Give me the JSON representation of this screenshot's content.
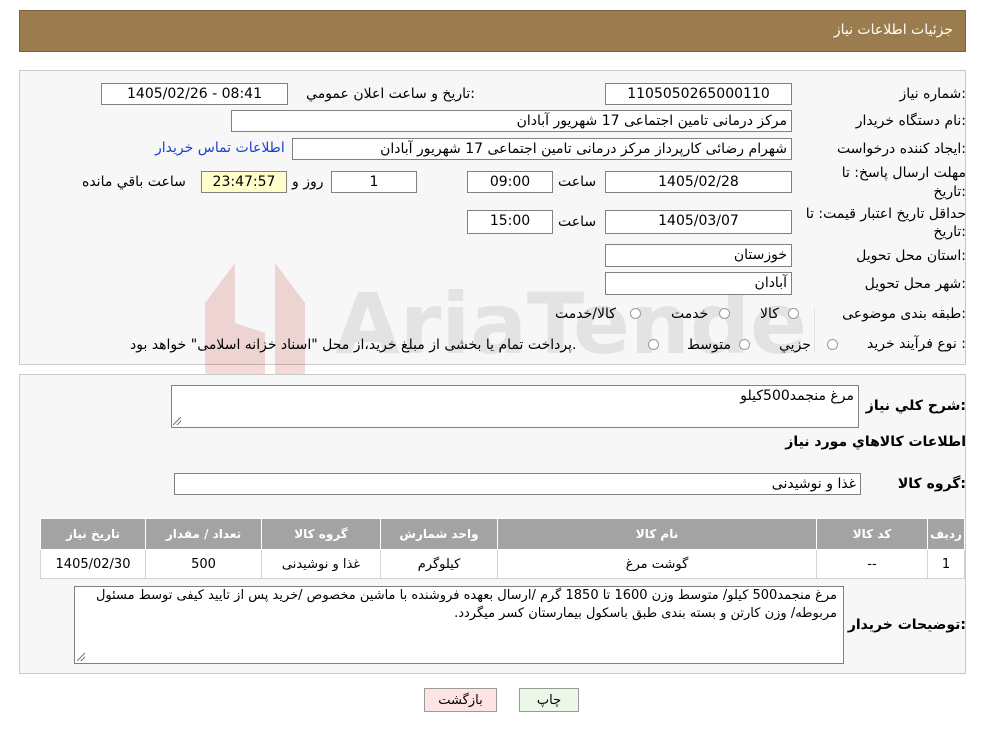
{
  "header": {
    "title": "جزئیات اطلاعات نیاز"
  },
  "form": {
    "need_number_label": "شماره نیاز:",
    "need_number": "1105050265000110",
    "announce_label": "تاریخ و ساعت اعلان عمومي:",
    "announce_value": "1405/02/26 - 08:41",
    "buyer_org_label": "نام دستگاه خریدار:",
    "buyer_org": "مرکز درمانی تامین اجتماعی 17 شهریور آبادان",
    "creator_label": "ایجاد کننده درخواست:",
    "creator": "شهرام رضائی کارپرداز مرکز درمانی تامین اجتماعی 17 شهریور آبادان",
    "contact_link": "اطلاعات تماس خریدار",
    "deadline_label_1": "مهلت ارسال پاسخ: تا",
    "deadline_label_2": "تاریخ:",
    "deadline_date": "1405/02/28",
    "time_label": "ساعت",
    "deadline_time": "09:00",
    "days_value": "1",
    "days_label": "روز و",
    "remaining_time": "23:47:57",
    "remaining_label": "ساعت باقي مانده",
    "validity_label_1": "حداقل تاريخ اعتبار قيمت: تا",
    "validity_label_2": "تاريخ:",
    "validity_date": "1405/03/07",
    "validity_time": "15:00",
    "province_label": "استان محل تحویل:",
    "province": "خوزستان",
    "city_label": "شهر محل تحویل:",
    "city": "آبادان",
    "category_label": "طبقه بندی موضوعی:",
    "category_options": [
      "کالا",
      "خدمت",
      "کالا/خدمت"
    ],
    "process_label": "نوع فرآیند خرید :",
    "process_options": [
      "جزیي",
      "متوسط"
    ],
    "process_note": "پرداخت تمام یا بخشی از مبلغ خرید،از محل \"اسناد خزانه اسلامی\" خواهد بود."
  },
  "summary": {
    "desc_label": "شرح کلي نياز:",
    "desc_value": "مرغ منجمد500کیلو",
    "items_title": "اطلاعات کالاهاي مورد نياز",
    "group_label": "گروه کالا:",
    "group_value": "غذا و نوشیدنی"
  },
  "table": {
    "headers": [
      "رديف",
      "کد کالا",
      "نام کالا",
      "واحد شمارش",
      "گروه کالا",
      "تعداد / مقدار",
      "تاریخ نیاز"
    ],
    "rows": [
      [
        "1",
        "--",
        "گوشت مرغ",
        "کیلوگرم",
        "غذا و نوشیدنی",
        "500",
        "1405/02/30"
      ]
    ]
  },
  "buyer_notes": {
    "label": "توضیحات خریدار:",
    "text": "مرغ منجمد500 کیلو/ متوسط وزن 1600 تا 1850 گرم /ارسال بعهده فروشنده با ماشین مخصوص /خرید پس از تایید کیفی توسط مسئول مربوطه/ وزن کارتن و بسته بندی طبق باسکول بیمارستان کسر میگردد."
  },
  "buttons": {
    "print": "چاپ",
    "back": "بازگشت"
  },
  "watermark": {
    "text": "AriaTender.neT"
  },
  "colors": {
    "header_bg": "#9b7c4e",
    "table_header_bg": "#a3a3a3",
    "remaining_bg": "#ffffcc",
    "back_btn_bg": "#fde3e3",
    "print_btn_bg": "#ebf8e8",
    "link": "#1a3fd1"
  }
}
